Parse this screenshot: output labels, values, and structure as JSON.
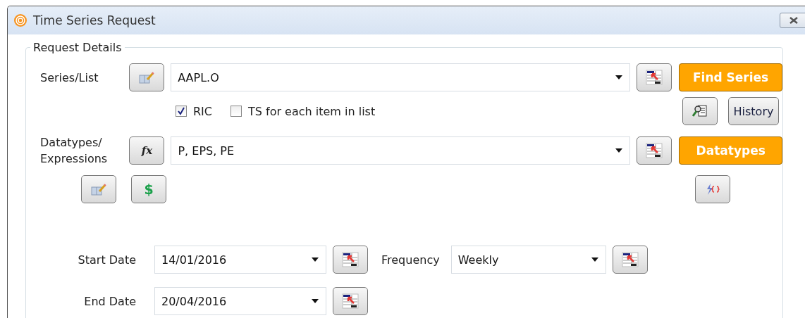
{
  "window": {
    "title": "Time Series Request"
  },
  "group": {
    "title": "Request Details"
  },
  "series": {
    "label": "Series/List",
    "value": "AAPL.O"
  },
  "checkboxes": [
    {
      "label": "RIC",
      "checked": true
    },
    {
      "label": "TS for each item in list",
      "checked": false
    }
  ],
  "find_button": "Find Series",
  "history_button": "History",
  "datatypes": {
    "label": "Datatypes/ Expressions",
    "function_button": "fx",
    "currency_button": "$",
    "value": "P, EPS, PE"
  },
  "datatypes_button": "Datatypes",
  "start_date": {
    "label": "Start Date",
    "value": "14/01/2016"
  },
  "frequency": {
    "label": "Frequency",
    "value": "Weekly"
  },
  "end_date": {
    "label": "End Date",
    "value": "20/04/2016"
  }
}
